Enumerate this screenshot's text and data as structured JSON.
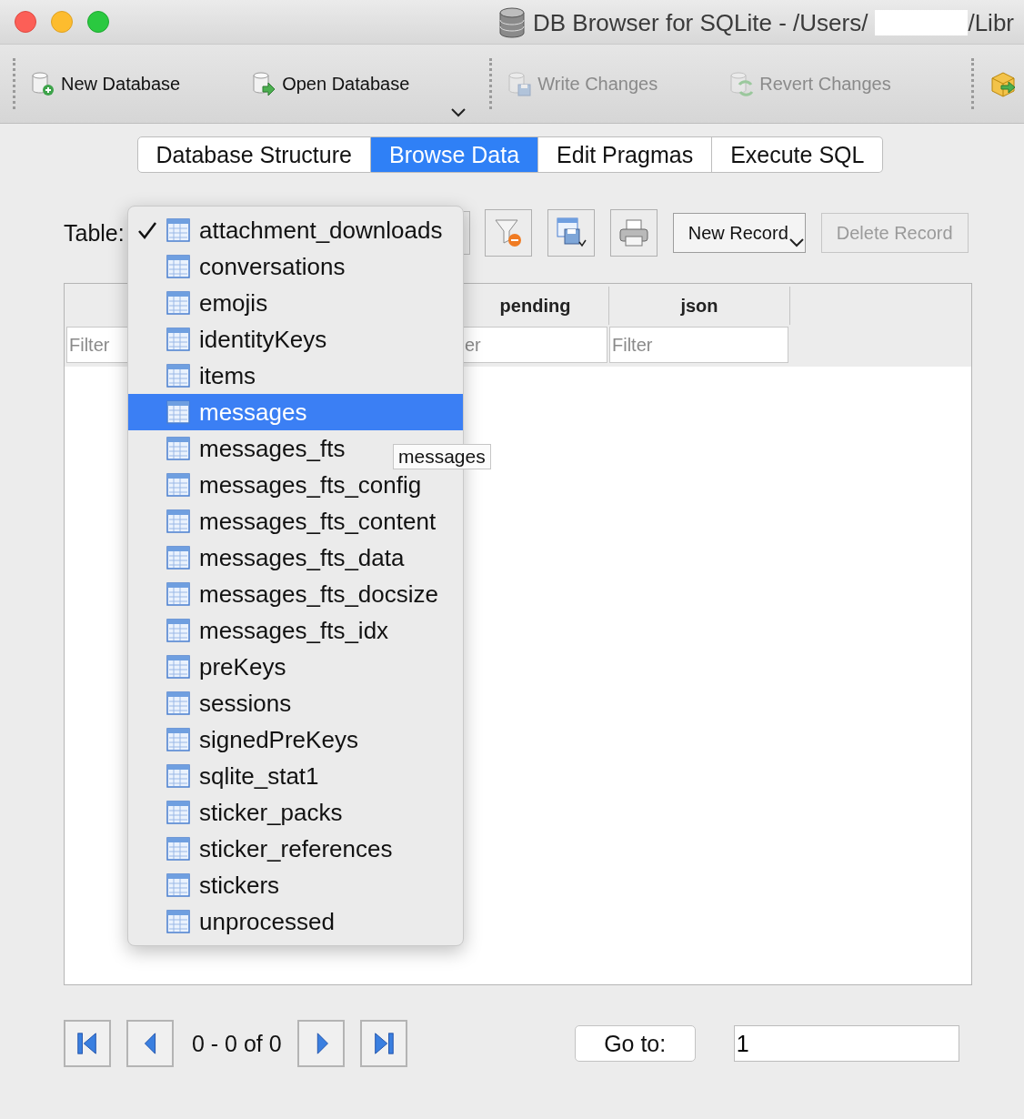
{
  "window": {
    "title_parts": [
      "DB Browser for SQLite - /Users/",
      "/Libr"
    ]
  },
  "toolbar": {
    "groups": [
      {
        "menu": true,
        "buttons": [
          {
            "kind": "new_db",
            "label": "New Database",
            "disabled": false
          },
          {
            "kind": "open_db",
            "label": "Open Database",
            "disabled": false
          }
        ]
      },
      {
        "buttons": [
          {
            "kind": "write",
            "label": "Write Changes",
            "disabled": true
          },
          {
            "kind": "revert",
            "label": "Revert Changes",
            "disabled": true
          }
        ]
      },
      {
        "buttons": [
          {
            "kind": "export"
          }
        ]
      }
    ]
  },
  "tabs": [
    {
      "label": "Database Structure",
      "selected": false
    },
    {
      "label": "Browse Data",
      "selected": true
    },
    {
      "label": "Edit Pragmas",
      "selected": false
    },
    {
      "label": "Execute SQL",
      "selected": false
    }
  ],
  "table_bar": {
    "label": "Table:",
    "tools": [
      {
        "kind": "clear_filter"
      },
      {
        "kind": "save"
      },
      {
        "kind": "print"
      }
    ],
    "buttons": [
      {
        "label": "New Record",
        "menu": true,
        "disabled": false
      },
      {
        "label": "Delete Record",
        "menu": false,
        "disabled": true
      }
    ]
  },
  "grid": {
    "columns": [
      {
        "placeholder": "Filter"
      },
      {
        "header": "pending",
        "placeholder": "er"
      },
      {
        "header": "json",
        "placeholder": "Filter"
      }
    ]
  },
  "table_menu": {
    "items": [
      {
        "label": "attachment_downloads",
        "checked": true,
        "selected": false
      },
      {
        "label": "conversations",
        "checked": false,
        "selected": false
      },
      {
        "label": "emojis",
        "checked": false,
        "selected": false
      },
      {
        "label": "identityKeys",
        "checked": false,
        "selected": false
      },
      {
        "label": "items",
        "checked": false,
        "selected": false
      },
      {
        "label": "messages",
        "checked": false,
        "selected": true
      },
      {
        "label": "messages_fts",
        "checked": false,
        "selected": false
      },
      {
        "label": "messages_fts_config",
        "checked": false,
        "selected": false
      },
      {
        "label": "messages_fts_content",
        "checked": false,
        "selected": false
      },
      {
        "label": "messages_fts_data",
        "checked": false,
        "selected": false
      },
      {
        "label": "messages_fts_docsize",
        "checked": false,
        "selected": false
      },
      {
        "label": "messages_fts_idx",
        "checked": false,
        "selected": false
      },
      {
        "label": "preKeys",
        "checked": false,
        "selected": false
      },
      {
        "label": "sessions",
        "checked": false,
        "selected": false
      },
      {
        "label": "signedPreKeys",
        "checked": false,
        "selected": false
      },
      {
        "label": "sqlite_stat1",
        "checked": false,
        "selected": false
      },
      {
        "label": "sticker_packs",
        "checked": false,
        "selected": false
      },
      {
        "label": "sticker_references",
        "checked": false,
        "selected": false
      },
      {
        "label": "stickers",
        "checked": false,
        "selected": false
      },
      {
        "label": "unprocessed",
        "checked": false,
        "selected": false
      }
    ]
  },
  "tooltip": {
    "text": "messages"
  },
  "pager": {
    "buttons": [
      {
        "kind": "first"
      },
      {
        "kind": "prev"
      },
      {
        "kind": "next"
      },
      {
        "kind": "last"
      }
    ],
    "range": "0 - 0 of 0",
    "goto_label": "Go to:",
    "goto_value": "1"
  }
}
